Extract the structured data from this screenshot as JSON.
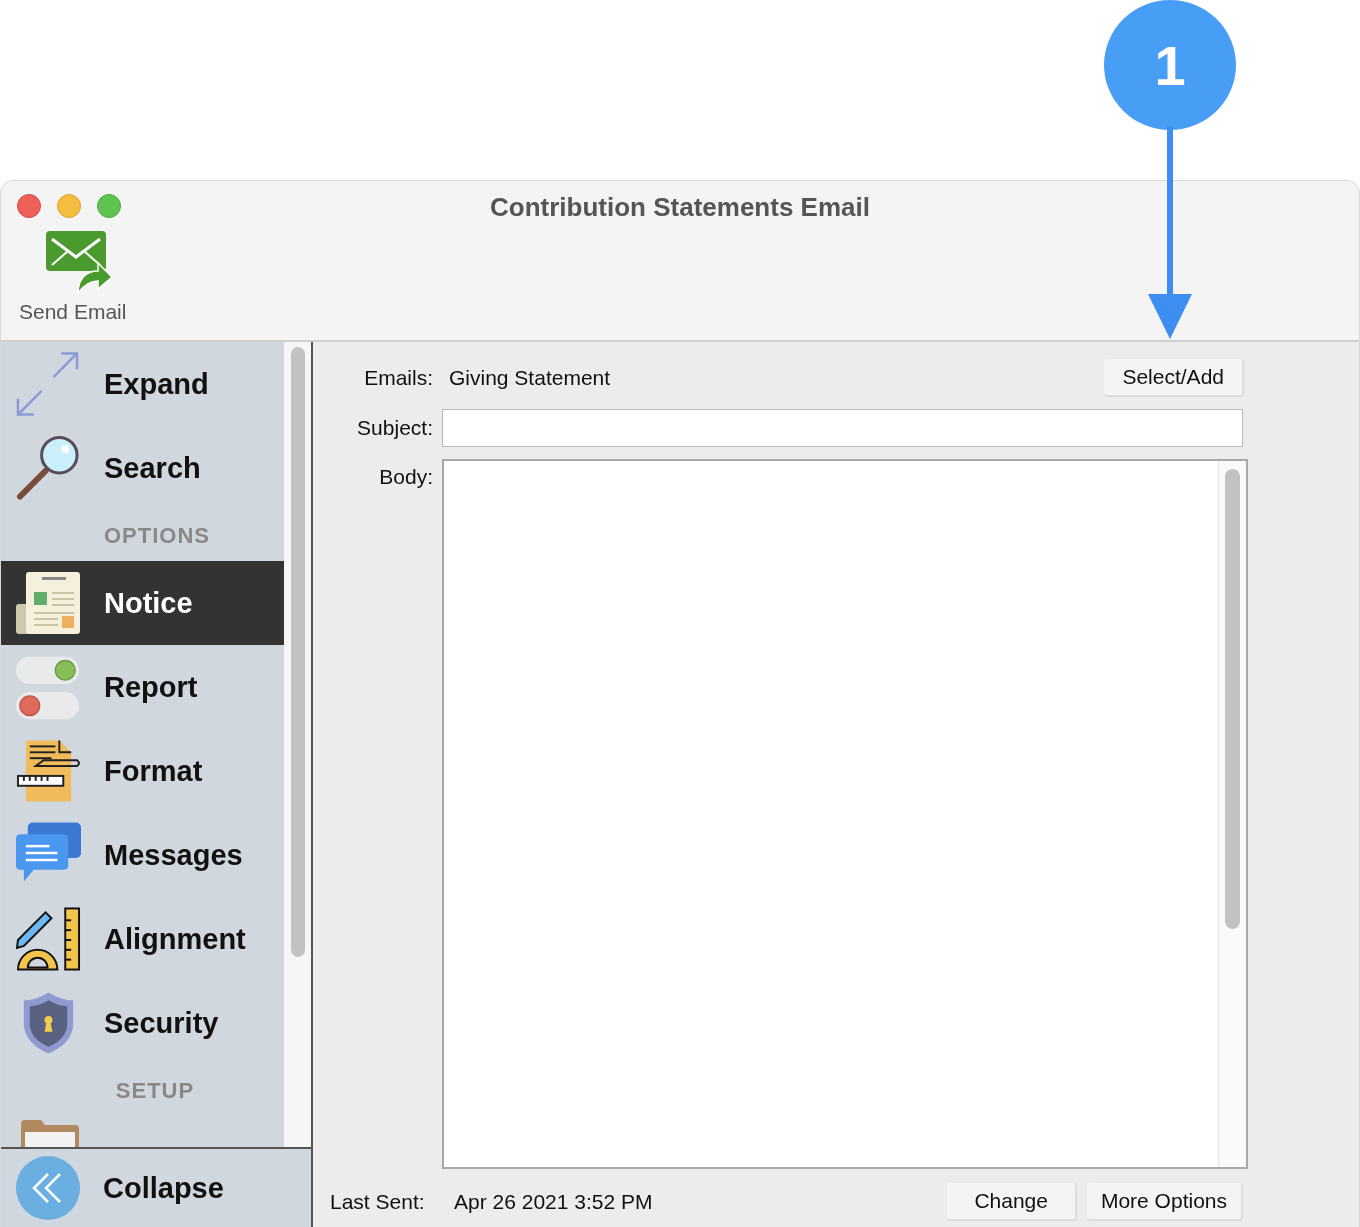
{
  "callout": {
    "number": "1"
  },
  "window": {
    "title": "Contribution Statements Email"
  },
  "toolbar": [
    {
      "label": "Send Email"
    }
  ],
  "sidebar": {
    "items": [
      {
        "kind": "item",
        "label": "Expand",
        "selected": false
      },
      {
        "kind": "item",
        "label": "Search",
        "selected": false
      },
      {
        "kind": "header",
        "label": "OPTIONS"
      },
      {
        "kind": "item",
        "label": "Notice",
        "selected": true
      },
      {
        "kind": "item",
        "label": "Report",
        "selected": false
      },
      {
        "kind": "item",
        "label": "Format",
        "selected": false
      },
      {
        "kind": "item",
        "label": "Messages",
        "selected": false
      },
      {
        "kind": "item",
        "label": "Alignment",
        "selected": false
      },
      {
        "kind": "item",
        "label": "Security",
        "selected": false
      },
      {
        "kind": "header",
        "label": "SETUP"
      }
    ],
    "collapse": {
      "label": "Collapse"
    }
  },
  "form": {
    "emails": {
      "label": "Emails:",
      "value": "Giving Statement",
      "button": "Select/Add"
    },
    "subject": {
      "label": "Subject:"
    },
    "body": {
      "label": "Body:"
    },
    "last_sent": {
      "label": "Last Sent:",
      "value": "Apr 26 2021 3:52 PM"
    },
    "buttons": [
      "Change",
      "More Options"
    ]
  }
}
